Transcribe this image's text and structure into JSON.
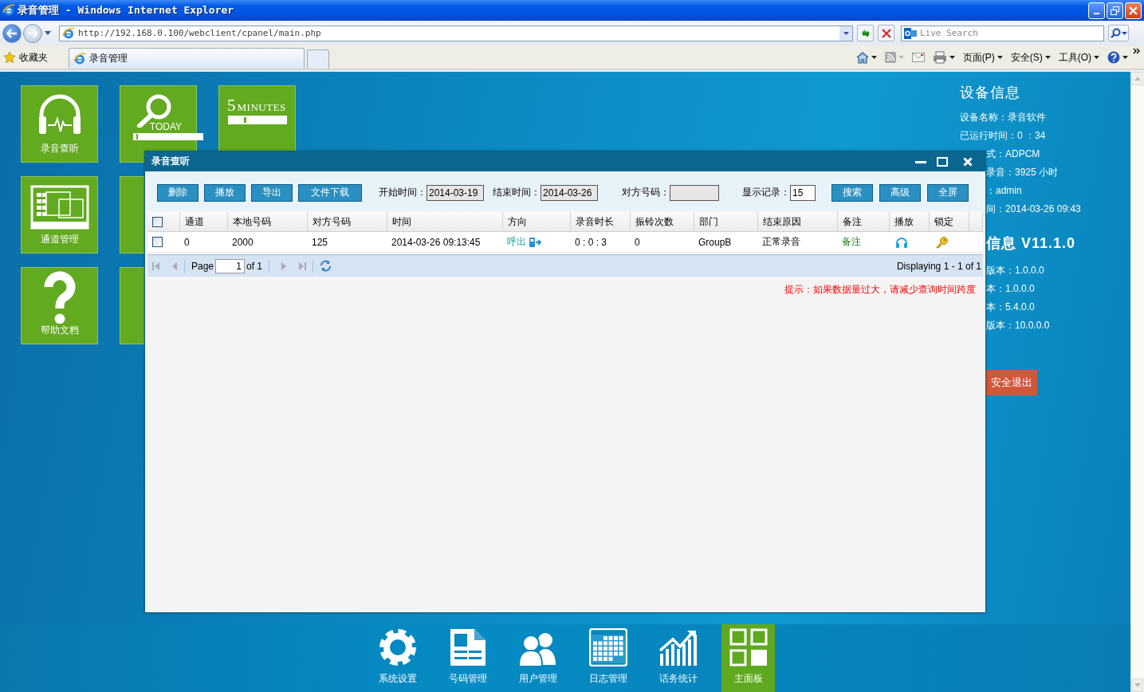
{
  "browser": {
    "title": "录音管理 - Windows Internet Explorer",
    "address": "http://192.168.0.100/webclient/cpanel/main.php",
    "search_placeholder": "Live Search",
    "favorites": "收藏夹",
    "tab": "录音管理",
    "menus": [
      "页面(P)",
      "安全(S)",
      "工具(O)"
    ]
  },
  "tiles": [
    {
      "kind": "headphones",
      "label": "录音查听"
    },
    {
      "kind": "today",
      "caption": "TODAY"
    },
    {
      "kind": "minutes",
      "number": "5",
      "caption": "MINUTES"
    },
    {
      "kind": "channels",
      "label": "通道管理"
    },
    {
      "kind": "blank"
    },
    {
      "kind": "help",
      "label": "帮助文档"
    },
    {
      "kind": "blank"
    }
  ],
  "device_info": {
    "title": "设备信息",
    "lines": [
      "设备名称：录音软件",
      "已运行时间：0 ：34"
    ],
    "partly_covered_lines": [
      "式：ADPCM",
      "录音：3925 小时",
      "：admin",
      "间：2014-03-26 09:43"
    ]
  },
  "version_info": {
    "title": "信息 V11.1.0",
    "lines": [
      "版本：1.0.0.0",
      "本：1.0.0.0",
      "本：5.4.0.0",
      "版本：10.0.0.0"
    ]
  },
  "logout_button": "安全退出",
  "dialog": {
    "title": "录音查听",
    "buttons": [
      "删除",
      "播放",
      "导出",
      "文件下载"
    ],
    "filters": [
      {
        "label": "开始时间：",
        "value": "2014-03-19"
      },
      {
        "label": "结束时间：",
        "value": "2014-03-26"
      },
      {
        "label": "对方号码："
      },
      {
        "label": "显示记录：",
        "value": "15"
      }
    ],
    "actions": [
      "搜索",
      "高级",
      "全屏"
    ],
    "select_all_checked": false,
    "columns": [
      {
        "label": "通道",
        "kind": "text"
      },
      {
        "label": "本地号码",
        "kind": "text"
      },
      {
        "label": "对方号码",
        "kind": "text"
      },
      {
        "label": "时间",
        "kind": "text"
      },
      {
        "label": "方向",
        "kind": "direction"
      },
      {
        "label": "录音时长",
        "kind": "text"
      },
      {
        "label": "振铃次数",
        "kind": "text"
      },
      {
        "label": "部门",
        "kind": "text"
      },
      {
        "label": "结束原因",
        "kind": "text"
      },
      {
        "label": "备注",
        "kind": "link"
      },
      {
        "label": "播放",
        "kind": "play"
      },
      {
        "label": "锁定",
        "kind": "lock"
      }
    ],
    "rows": [
      {
        "checked": false,
        "cells": [
          "0",
          "2000",
          "125",
          "2014-03-26 09:13:45",
          "呼出",
          "0 : 0 : 3",
          "0",
          "GroupB",
          "正常录音",
          "备注"
        ]
      }
    ],
    "pager": {
      "label": "Page",
      "page": "1",
      "of": "of 1",
      "displaying": "Displaying 1 - 1 of 1"
    },
    "tip": "提示：如果数据量过大，请减少查询时间跨度"
  },
  "nav": [
    {
      "kind": "gear",
      "label": "系统设置",
      "selected": false
    },
    {
      "kind": "document",
      "label": "号码管理",
      "selected": false
    },
    {
      "kind": "users",
      "label": "用户管理",
      "selected": false
    },
    {
      "kind": "calendar",
      "label": "日志管理",
      "selected": false
    },
    {
      "kind": "chart",
      "label": "话务统计",
      "selected": false
    },
    {
      "kind": "grid",
      "label": "主面板",
      "selected": true
    }
  ]
}
